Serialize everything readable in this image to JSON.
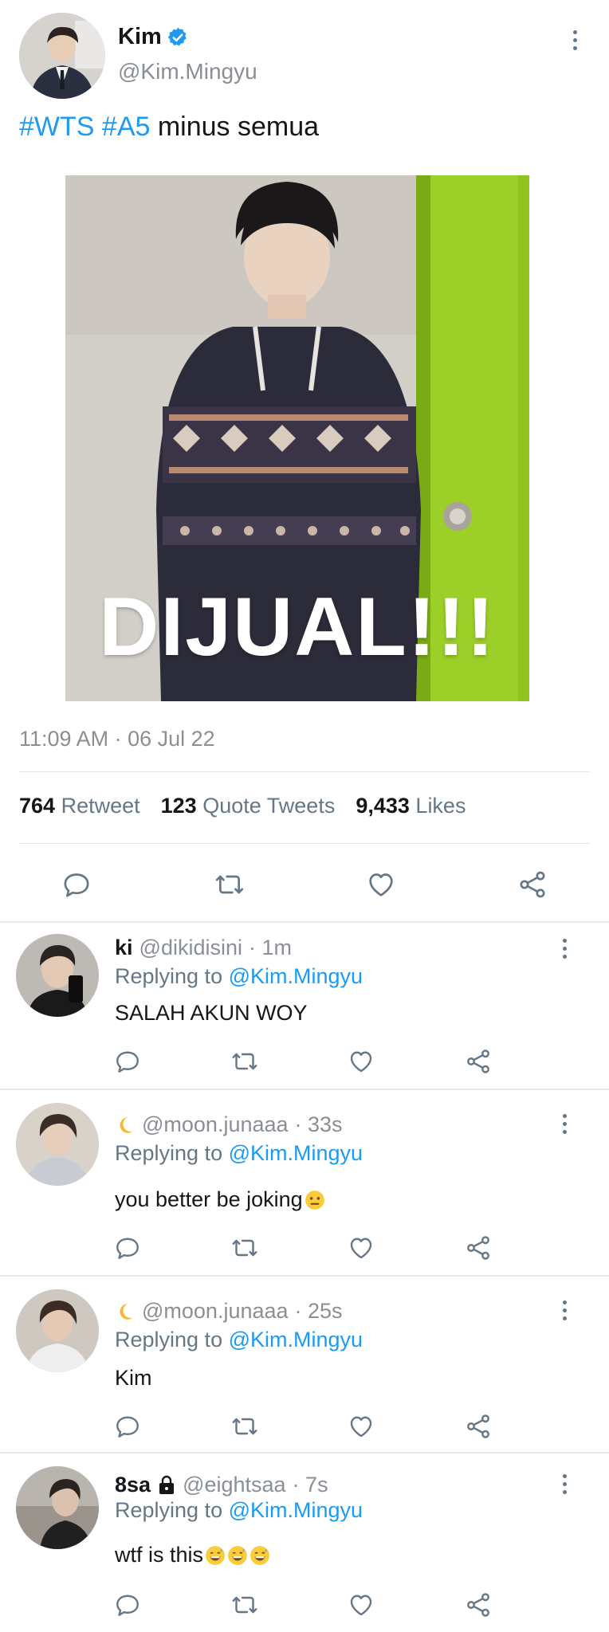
{
  "tweet": {
    "display_name": "Kim",
    "handle": "@Kim.Mingyu",
    "hashtag1": "#WTS",
    "hashtag2": "#A5",
    "text": "minus semua",
    "image_overlay": "DIJUAL!!!",
    "timestamp": "11:09 AM · 06 Jul 22",
    "stats": {
      "retweets": "764",
      "retweets_label": "Retweet",
      "quotes": "123",
      "quotes_label": "Quote Tweets",
      "likes": "9,433",
      "likes_label": "Likes"
    }
  },
  "replying_label": "Replying to",
  "replies": [
    {
      "name": "ki",
      "handle": "@dikidisini",
      "time": "· 1m",
      "replying_to": "@Kim.Mingyu",
      "text": "SALAH AKUN WOY"
    },
    {
      "handle": "@moon.junaaa",
      "time": "· 33s",
      "replying_to": "@Kim.Mingyu",
      "text": "you better be joking"
    },
    {
      "handle": "@moon.junaaa",
      "time": "· 25s",
      "replying_to": "@Kim.Mingyu",
      "text": "Kim"
    },
    {
      "name": "8sa",
      "handle": "@eightsaa",
      "time": "· 7s",
      "replying_to": "@Kim.Mingyu",
      "text": "wtf is this"
    }
  ],
  "icons": {
    "reply": "speech-bubble-icon",
    "retweet": "retweet-icon",
    "like": "heart-icon",
    "share": "share-icon",
    "more": "more-vertical-icon"
  },
  "colors": {
    "accent": "#1d9bf0",
    "muted": "#657786",
    "divider": "#e1e5e8"
  }
}
